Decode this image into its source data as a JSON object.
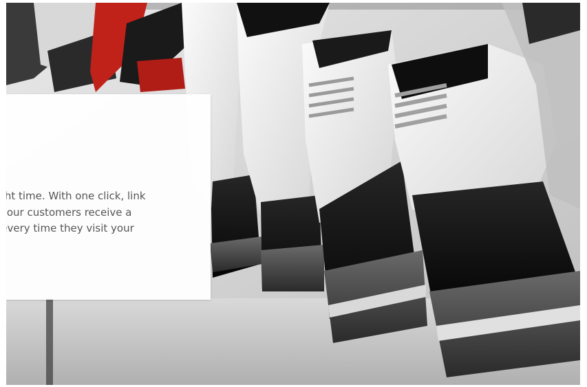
{
  "hero": {
    "image_alt": "Row of sneakers hanging on a rack, black and white with red accent",
    "accent_color": "#c0221a",
    "card": {
      "text_lines": [
        "right time. With one click, link",
        "e your customers receive a",
        "n every time they visit your"
      ]
    }
  }
}
